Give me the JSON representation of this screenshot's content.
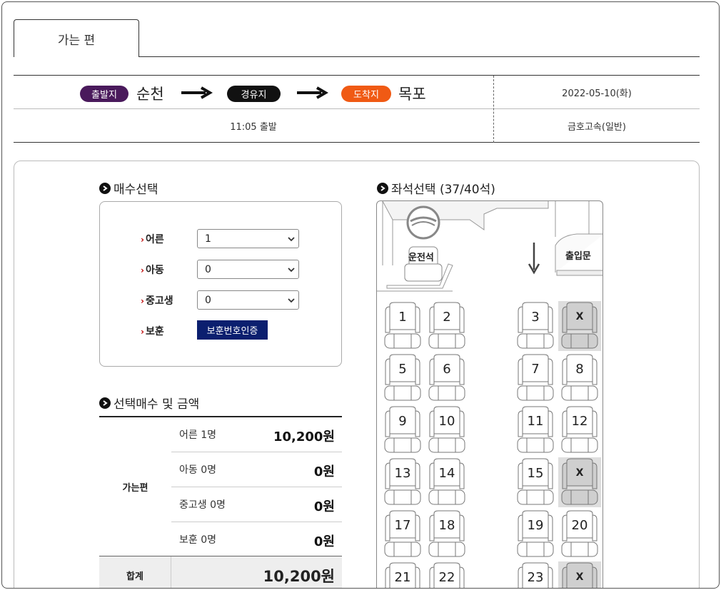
{
  "tab": {
    "label": "가는 편"
  },
  "route": {
    "departure_badge": "출발지",
    "departure_city": "순천",
    "via_badge": "경유지",
    "arrival_badge": "도착지",
    "arrival_city": "목포",
    "date": "2022-05-10(화)",
    "departure_time": "11:05 출발",
    "operator": "금호고속(일반)",
    "colors": {
      "departure": "#4a1a5c",
      "via": "#111111",
      "arrival": "#f05a14"
    }
  },
  "count_section": {
    "title": "매수선택",
    "rows": [
      {
        "label": "어른",
        "value": "1"
      },
      {
        "label": "아동",
        "value": "0"
      },
      {
        "label": "중고생",
        "value": "0"
      }
    ],
    "veteran": {
      "label": "보훈",
      "button": "보훈번호인증"
    }
  },
  "price_section": {
    "title": "선택매수 및 금액",
    "trip_label": "가는편",
    "rows": [
      {
        "name": "어른 1명",
        "amount": "10,200원"
      },
      {
        "name": "아동 0명",
        "amount": "0원"
      },
      {
        "name": "중고생 0명",
        "amount": "0원"
      },
      {
        "name": "보훈 0명",
        "amount": "0원"
      }
    ],
    "total_label": "합계",
    "total_amount": "10,200원"
  },
  "seat_section": {
    "title": "좌석선택 (37/40석)",
    "driver_label": "운전석",
    "door_label": "출입문",
    "taken_mark": "X",
    "seats": [
      {
        "label": "1",
        "taken": false
      },
      {
        "label": "2",
        "taken": false
      },
      {
        "label": "3",
        "taken": false
      },
      {
        "label": "X",
        "taken": true
      },
      {
        "label": "5",
        "taken": false
      },
      {
        "label": "6",
        "taken": false
      },
      {
        "label": "7",
        "taken": false
      },
      {
        "label": "8",
        "taken": false
      },
      {
        "label": "9",
        "taken": false
      },
      {
        "label": "10",
        "taken": false
      },
      {
        "label": "11",
        "taken": false
      },
      {
        "label": "12",
        "taken": false
      },
      {
        "label": "13",
        "taken": false
      },
      {
        "label": "14",
        "taken": false
      },
      {
        "label": "15",
        "taken": false
      },
      {
        "label": "X",
        "taken": true
      },
      {
        "label": "17",
        "taken": false
      },
      {
        "label": "18",
        "taken": false
      },
      {
        "label": "19",
        "taken": false
      },
      {
        "label": "20",
        "taken": false
      },
      {
        "label": "21",
        "taken": false
      },
      {
        "label": "22",
        "taken": false
      },
      {
        "label": "23",
        "taken": false
      },
      {
        "label": "X",
        "taken": true
      }
    ]
  }
}
